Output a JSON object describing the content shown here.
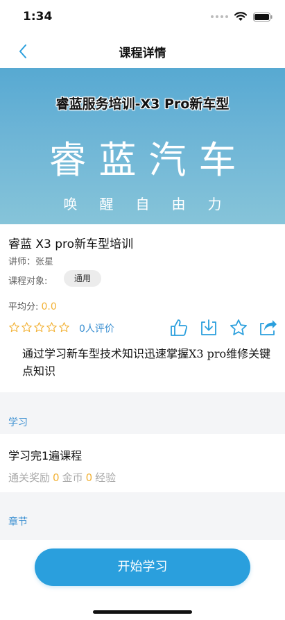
{
  "status": {
    "time": "1:34"
  },
  "nav": {
    "title": "课程详情"
  },
  "banner": {
    "title": "睿蓝服务培训-X3 Pro新车型",
    "brand": "睿蓝汽车",
    "slogan": "唤醒自由力"
  },
  "course": {
    "title": "睿蓝 X3 pro新车型培训",
    "teacher": "讲师：张星",
    "audience_label": "课程对象:",
    "audience_value": "通用",
    "score_label": "平均分: ",
    "score_value": "0.0",
    "review_count": "0人评价",
    "description": "通过学习新车型技术知识迅速掌握X3 pro维修关键点知识"
  },
  "study": {
    "section_label": "学习",
    "task": "学习完1遍课程",
    "reward_label": "通关奖励",
    "coins_value": "0",
    "coins_label": "金币",
    "exp_value": "0",
    "exp_label": "经验"
  },
  "chapters": {
    "section_label": "章节"
  },
  "footer": {
    "start_label": "开始学习"
  },
  "colors": {
    "accent": "#2a9fdd",
    "link": "#3a8fd1",
    "star": "#f2b134"
  }
}
